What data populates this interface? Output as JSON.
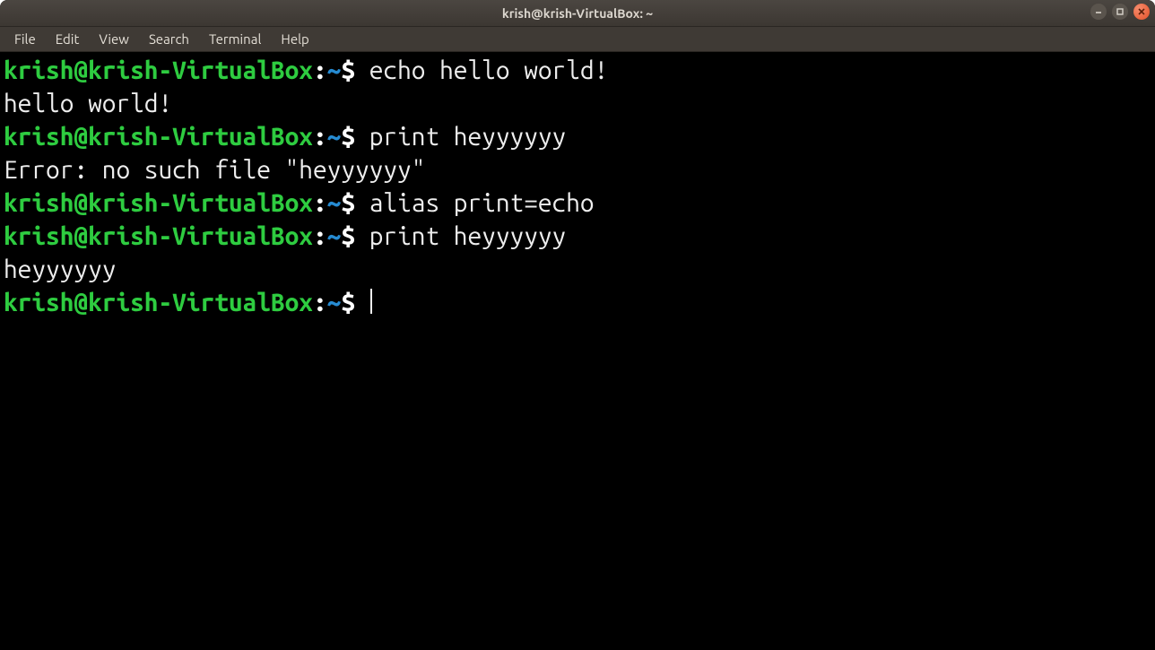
{
  "window": {
    "title": "krish@krish-VirtualBox: ~"
  },
  "menubar": {
    "items": [
      "File",
      "Edit",
      "View",
      "Search",
      "Terminal",
      "Help"
    ]
  },
  "prompt": {
    "userhost": "krish@krish-VirtualBox",
    "colon": ":",
    "path": "~",
    "dollar": "$"
  },
  "session": {
    "lines": [
      {
        "type": "cmd",
        "text": "echo hello world!"
      },
      {
        "type": "out",
        "text": "hello world!"
      },
      {
        "type": "cmd",
        "text": "print heyyyyyy"
      },
      {
        "type": "out",
        "text": "Error: no such file \"heyyyyyy\""
      },
      {
        "type": "cmd",
        "text": "alias print=echo"
      },
      {
        "type": "cmd",
        "text": "print heyyyyyy"
      },
      {
        "type": "out",
        "text": "heyyyyyy"
      },
      {
        "type": "cmd",
        "text": "",
        "cursor": true
      }
    ]
  }
}
